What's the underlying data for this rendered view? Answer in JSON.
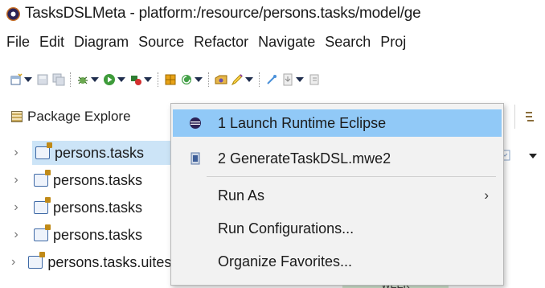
{
  "window": {
    "title": "TasksDSLMeta - platform:/resource/persons.tasks/model/ge"
  },
  "menubar": {
    "items": [
      "File",
      "Edit",
      "Diagram",
      "Source",
      "Refactor",
      "Navigate",
      "Search",
      "Proj"
    ]
  },
  "toolbar": {
    "icons": [
      "new-wizard-icon",
      "save-icon",
      "save-all-icon",
      "debug-icon",
      "run-icon",
      "external-tools-icon",
      "new-package-icon",
      "refresh-icon",
      "open-type-icon",
      "edit-icon",
      "toggle-mark-icon",
      "annotation-icon",
      "forward-icon"
    ]
  },
  "package_explorer": {
    "title": "Package Explore",
    "rows": [
      {
        "label": "persons.tasks",
        "selected": true
      },
      {
        "label": "persons.tasks",
        "selected": false
      },
      {
        "label": "persons.tasks",
        "selected": false
      },
      {
        "label": "persons.tasks",
        "selected": false
      },
      {
        "label": "persons.tasks.uitests",
        "selected": false
      }
    ]
  },
  "background": {
    "week_label": "WEEK"
  },
  "run_dropdown": {
    "items": [
      {
        "label": "1 Launch Runtime Eclipse",
        "icon": "eclipse-icon",
        "active": true
      },
      {
        "label": "2 GenerateTaskDSL.mwe2",
        "icon": "mwe2-file-icon",
        "active": false
      },
      {
        "label": "Run As",
        "submenu": true
      },
      {
        "label": "Run Configurations..."
      },
      {
        "label": "Organize Favorites..."
      }
    ],
    "colors": {
      "highlight": "#91c9f7",
      "background": "#f2f2f2"
    }
  }
}
